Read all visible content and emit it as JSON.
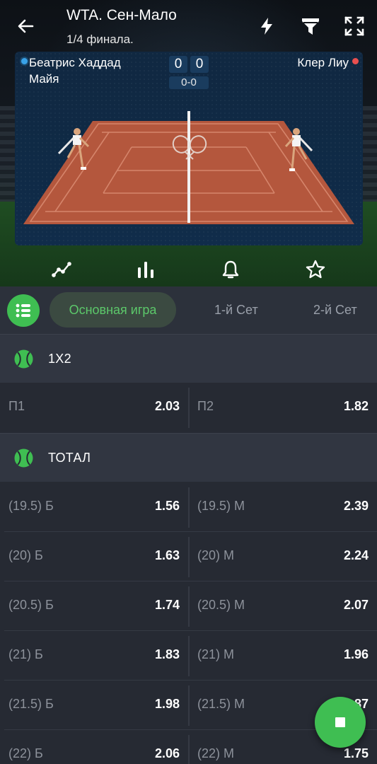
{
  "header": {
    "title": "WTA. Сен-Мало",
    "subtitle": "1/4 финала.",
    "icons": [
      "back-arrow-icon",
      "lightning-icon",
      "filter-icon",
      "expand-icon"
    ]
  },
  "match": {
    "player1_line1": "Беатрис Хаддад",
    "player1_line2": "Майя",
    "player2": "Клер Лиу",
    "player1_color": "#39a2e8",
    "player2_color": "#e84f4f",
    "score_left": "0",
    "score_right": "0",
    "game_score": "0-0"
  },
  "actions": [
    "chart-line-icon",
    "stats-bars-icon",
    "bell-icon",
    "star-icon"
  ],
  "tabs": {
    "items": [
      "Основная игра",
      "1-й Сет",
      "2-й Сет"
    ],
    "active": "Основная игра"
  },
  "markets": {
    "m1": {
      "title": "1X2",
      "rows": [
        {
          "l_label": "П1",
          "l_odd": "2.03",
          "r_label": "П2",
          "r_odd": "1.82"
        }
      ]
    },
    "m2": {
      "title": "ТОТАЛ",
      "rows": [
        {
          "l_label": "(19.5) Б",
          "l_odd": "1.56",
          "r_label": "(19.5) М",
          "r_odd": "2.39"
        },
        {
          "l_label": "(20) Б",
          "l_odd": "1.63",
          "r_label": "(20) М",
          "r_odd": "2.24"
        },
        {
          "l_label": "(20.5) Б",
          "l_odd": "1.74",
          "r_label": "(20.5) М",
          "r_odd": "2.07"
        },
        {
          "l_label": "(21) Б",
          "l_odd": "1.83",
          "r_label": "(21) М",
          "r_odd": "1.96"
        },
        {
          "l_label": "(21.5) Б",
          "l_odd": "1.98",
          "r_label": "(21.5) М",
          "r_odd": "1.87"
        },
        {
          "l_label": "(22) Б",
          "l_odd": "2.06",
          "r_label": "(22) М",
          "r_odd": "1.75"
        }
      ]
    }
  },
  "colors": {
    "accent": "#3fbe52",
    "background": "#262a33",
    "section_background": "#313641"
  }
}
